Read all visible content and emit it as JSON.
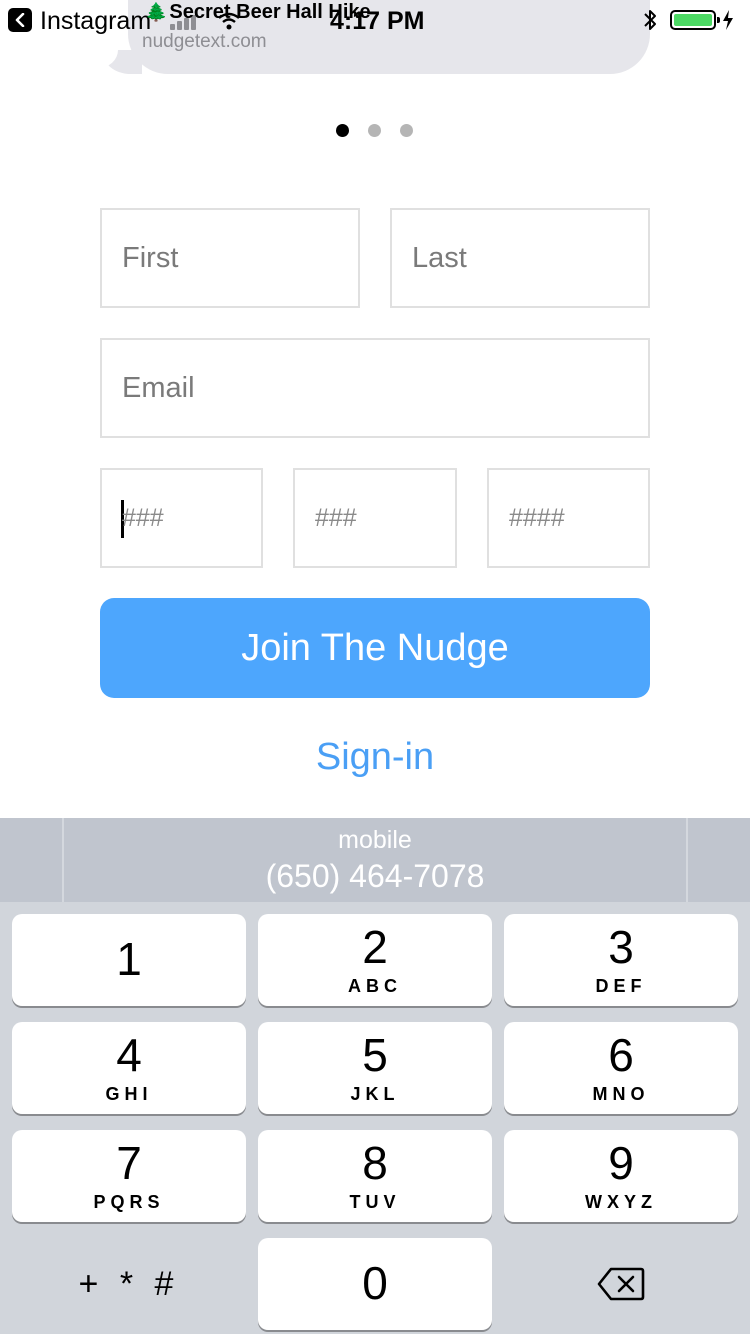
{
  "status_bar": {
    "back_app": "Instagram",
    "time": "4:17 PM",
    "battery_level": 1.0
  },
  "bubble": {
    "tree": "🌲",
    "title": "Secret Beer Hall Hike",
    "link": "nudgetext.com"
  },
  "pager": {
    "count": 3,
    "active": 0
  },
  "form": {
    "first_placeholder": "First",
    "last_placeholder": "Last",
    "email_placeholder": "Email",
    "phone_area_placeholder": "###",
    "phone_prefix_placeholder": "###",
    "phone_line_placeholder": "####",
    "join_label": "Join The Nudge",
    "signin_label": "Sign-in"
  },
  "autofill": {
    "label": "mobile",
    "value": "(650) 464-7078"
  },
  "keypad": {
    "keys": [
      {
        "num": "1",
        "letters": ""
      },
      {
        "num": "2",
        "letters": "ABC"
      },
      {
        "num": "3",
        "letters": "DEF"
      },
      {
        "num": "4",
        "letters": "GHI"
      },
      {
        "num": "5",
        "letters": "JKL"
      },
      {
        "num": "6",
        "letters": "MNO"
      },
      {
        "num": "7",
        "letters": "PQRS"
      },
      {
        "num": "8",
        "letters": "TUV"
      },
      {
        "num": "9",
        "letters": "WXYZ"
      },
      {
        "num": "0",
        "letters": ""
      }
    ],
    "symbols": "+ * #",
    "delete_icon": "backspace-icon"
  },
  "colors": {
    "accent": "#4da6fd",
    "link": "#4a9ff5",
    "keypad_bg": "#d1d5db",
    "autofill_bg": "#c0c5ce"
  }
}
